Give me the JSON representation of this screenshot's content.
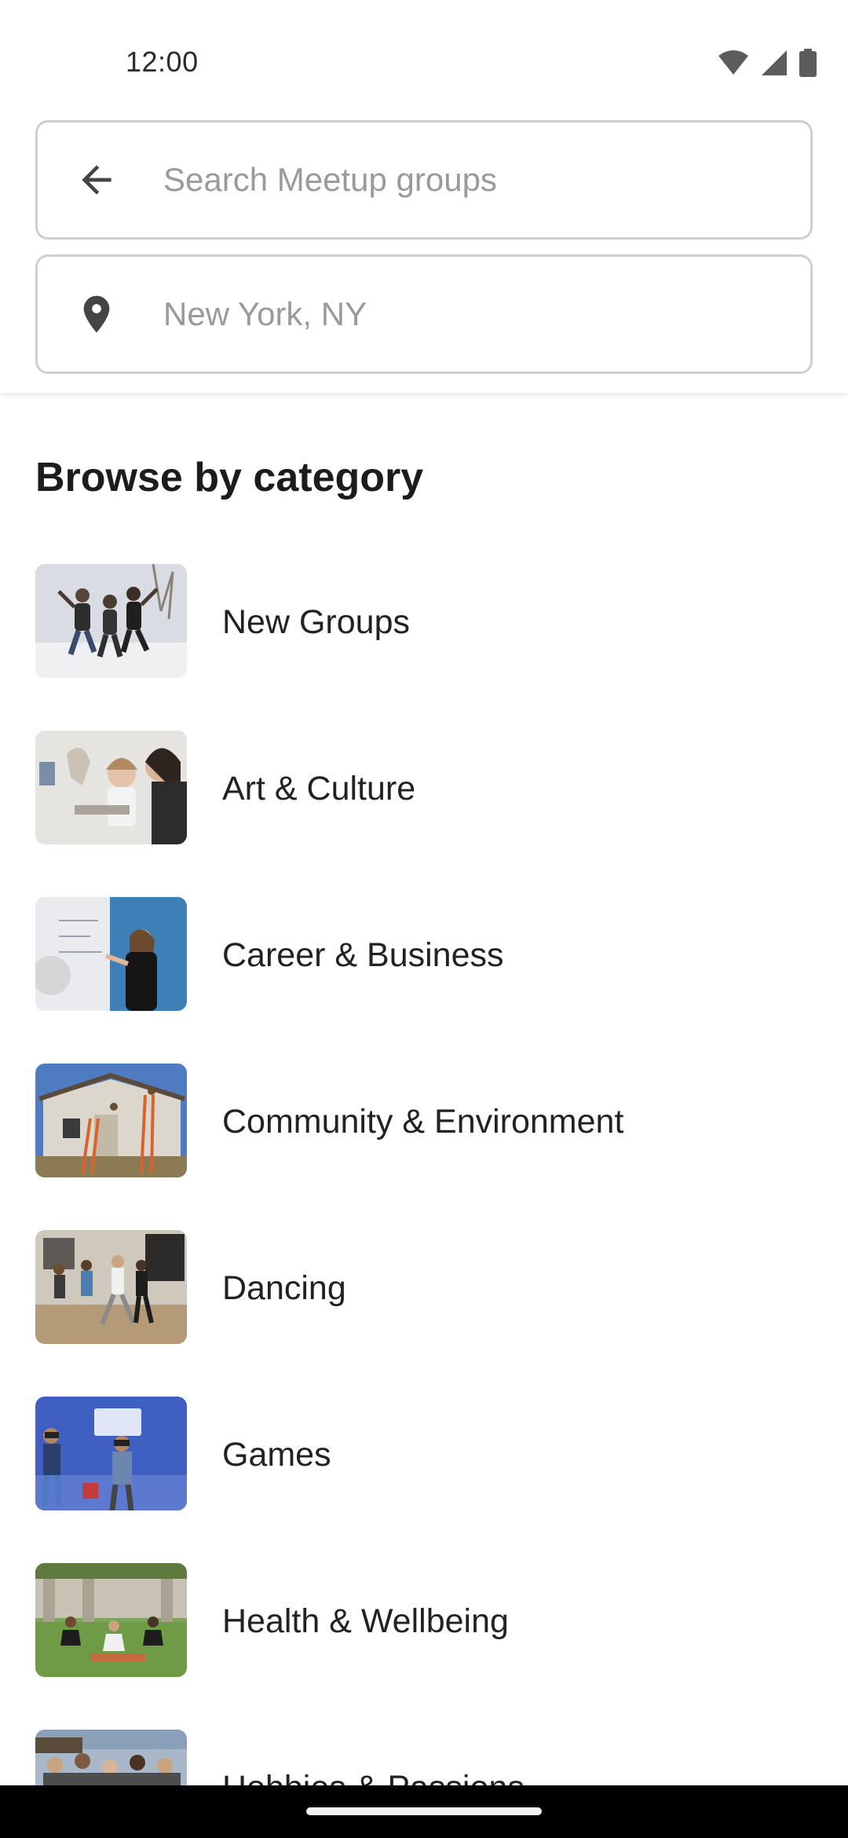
{
  "status_bar": {
    "time": "12:00",
    "icons": [
      "wifi-icon",
      "cellular-signal-icon",
      "battery-icon"
    ]
  },
  "search": {
    "back_icon": "arrow-back-icon",
    "placeholder": "Search Meetup groups",
    "value": ""
  },
  "location": {
    "icon": "location-pin-icon",
    "placeholder": "New York, NY",
    "value": ""
  },
  "section_title": "Browse by category",
  "categories": [
    {
      "label": "New Groups",
      "image": "people-jumping-photo"
    },
    {
      "label": "Art & Culture",
      "image": "art-class-photo"
    },
    {
      "label": "Career & Business",
      "image": "whiteboard-presentation-photo"
    },
    {
      "label": "Community & Environment",
      "image": "house-building-photo"
    },
    {
      "label": "Dancing",
      "image": "dance-class-photo"
    },
    {
      "label": "Games",
      "image": "vr-gaming-photo"
    },
    {
      "label": "Health & Wellbeing",
      "image": "outdoor-yoga-photo"
    },
    {
      "label": "Hobbies & Passions",
      "image": "crowd-photo"
    }
  ],
  "colors": {
    "field_border": "#cfcfcf",
    "placeholder": "#9a9a9a",
    "text": "#1c1c1c"
  }
}
